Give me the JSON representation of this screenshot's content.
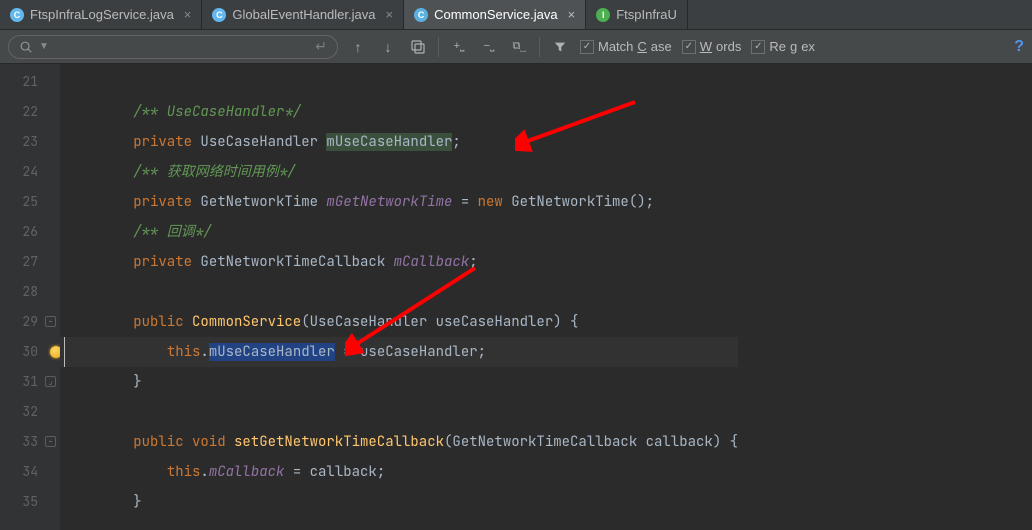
{
  "tabs": [
    {
      "icon": "C",
      "cls": "c-blue",
      "name": "FtspInfraLogService.java",
      "active": false
    },
    {
      "icon": "C",
      "cls": "c-blue",
      "name": "GlobalEventHandler.java",
      "active": false
    },
    {
      "icon": "C",
      "cls": "c-cyan",
      "name": "CommonService.java",
      "active": true
    },
    {
      "icon": "I",
      "cls": "i-green",
      "name": "FtspInfraU",
      "active": false
    }
  ],
  "toolbar": {
    "match": "Match ",
    "match_u": "C",
    "match2": "ase",
    "words_u": "W",
    "words2": "ords",
    "regex": "Re",
    "regex_u": "g",
    "regex2": "ex"
  },
  "lines": {
    "ln21": "21",
    "ln22": "22",
    "ln23": "23",
    "ln24": "24",
    "ln25": "25",
    "ln26": "26",
    "ln27": "27",
    "ln28": "28",
    "ln29": "29",
    "ln30": "30",
    "ln31": "31",
    "ln32": "32",
    "ln33": "33",
    "ln34": "34",
    "ln35": "35"
  },
  "code": {
    "c22": "/** UseCaseHandler*/",
    "c23_kw": "private",
    "c23_t": " UseCaseHandler ",
    "c23_f": "mUseCaseHandler",
    "c23_e": ";",
    "c24": "/** 获取网络时间用例*/",
    "c25_kw": "private",
    "c25_t": " GetNetworkTime ",
    "c25_f": "mGetNetworkTime",
    "c25_eq": " = ",
    "c25_nw": "new",
    "c25_c": " GetNetworkTime();",
    "c26": "/** 回调*/",
    "c27_kw": "private",
    "c27_t": " GetNetworkTimeCallback ",
    "c27_f": "mCallback",
    "c27_e": ";",
    "c29_kw": "public",
    "c29_n": " CommonService",
    "c29_p": "(UseCaseHandler useCaseHandler) {",
    "c30_th": "this",
    "c30_d": ".",
    "c30_f": "mUseCaseHandler",
    "c30_r": " = useCaseHandler;",
    "c31": "}",
    "c33_kw": "public",
    "c33_v": " void",
    "c33_n": " setGetNetworkTimeCallback",
    "c33_p": "(GetNetworkTimeCallback callback) {",
    "c34_th": "this",
    "c34_d": ".",
    "c34_f": "mCallback",
    "c34_r": " = callback;",
    "c35": "}"
  }
}
